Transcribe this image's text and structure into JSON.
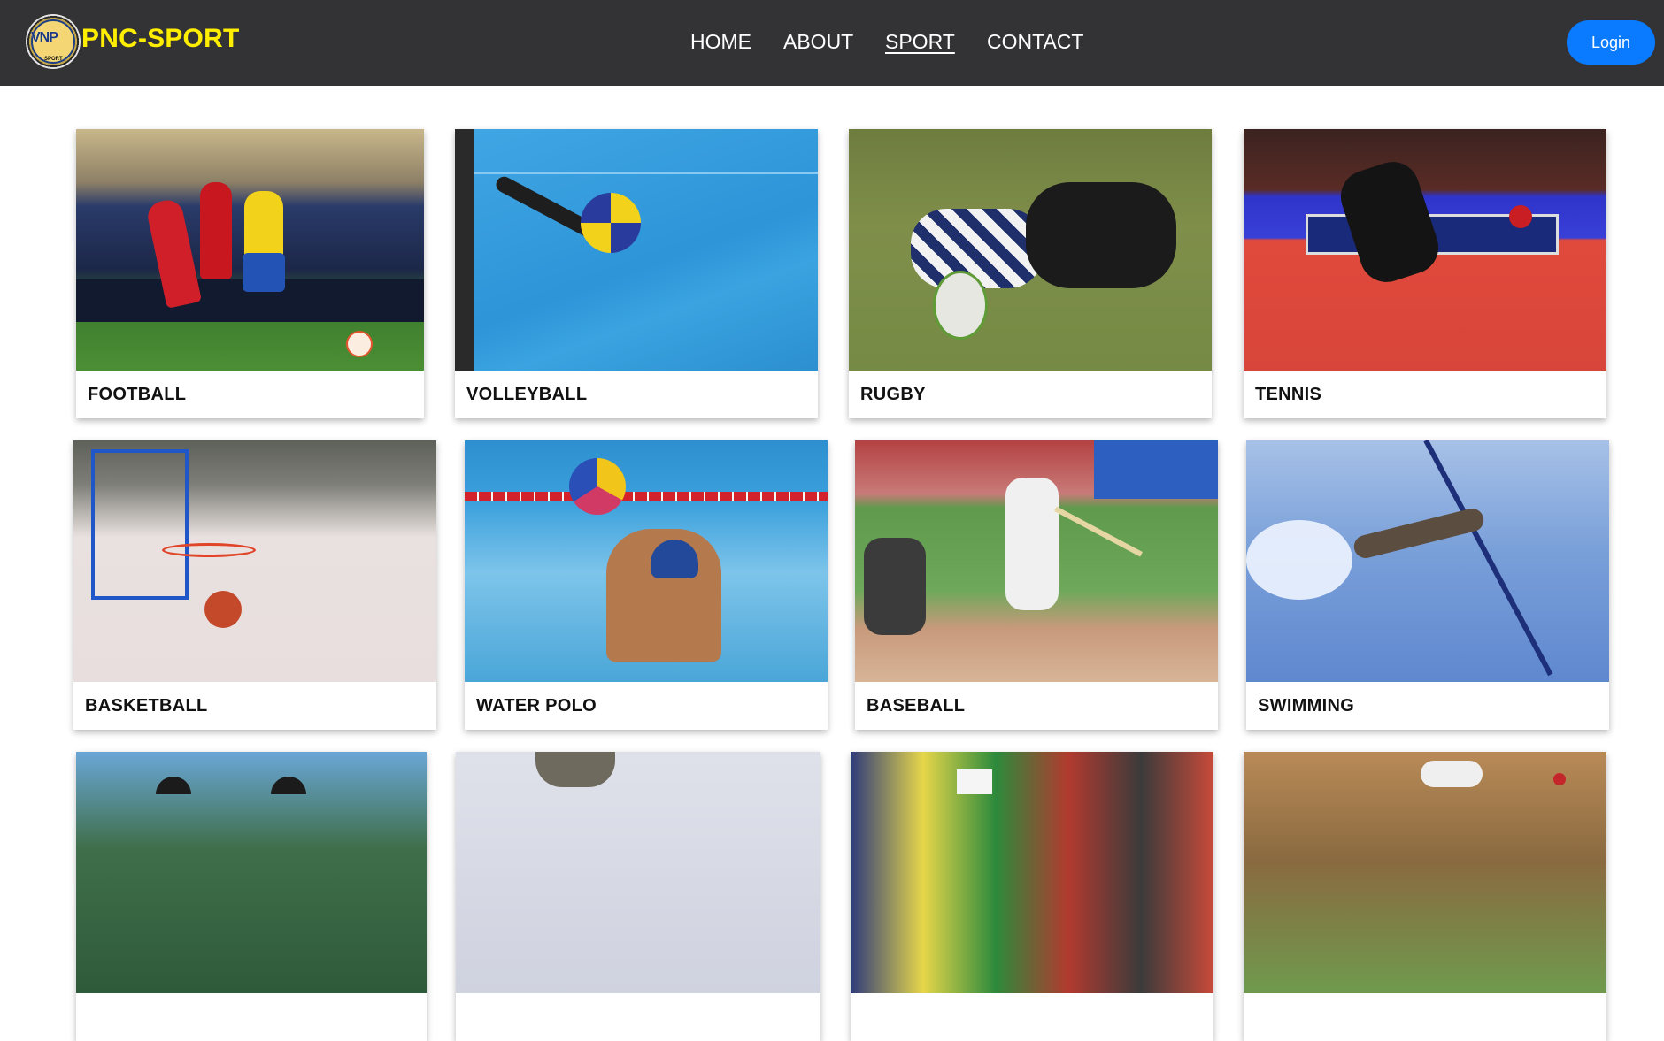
{
  "brand": {
    "name": "PNC-SPORT",
    "logo_text": "VNP",
    "logo_subtext": "SPORT"
  },
  "nav": {
    "items": [
      {
        "label": "HOME",
        "active": false
      },
      {
        "label": "ABOUT",
        "active": false
      },
      {
        "label": "SPORT",
        "active": true
      },
      {
        "label": "CONTACT",
        "active": false
      }
    ],
    "login_label": "Login"
  },
  "sports": [
    {
      "label": "FOOTBALL",
      "scene": "football-photo"
    },
    {
      "label": "VOLLEYBALL",
      "scene": "volleyball-photo"
    },
    {
      "label": "RUGBY",
      "scene": "rugby-photo"
    },
    {
      "label": "TENNIS",
      "scene": "table-tennis-photo"
    },
    {
      "label": "BASKETBALL",
      "scene": "basketball-photo"
    },
    {
      "label": "WATER POLO",
      "scene": "water-polo-photo"
    },
    {
      "label": "BASEBALL",
      "scene": "baseball-photo"
    },
    {
      "label": "SWIMMING",
      "scene": "swimming-photo"
    },
    {
      "label": "",
      "scene": "cycling-photo"
    },
    {
      "label": "",
      "scene": "hockey-photo"
    },
    {
      "label": "",
      "scene": "marathon-photo"
    },
    {
      "label": "",
      "scene": "cricket-photo"
    }
  ],
  "colors": {
    "navbar": "#333336",
    "brand": "#ffee00",
    "login": "#0a7bff"
  }
}
